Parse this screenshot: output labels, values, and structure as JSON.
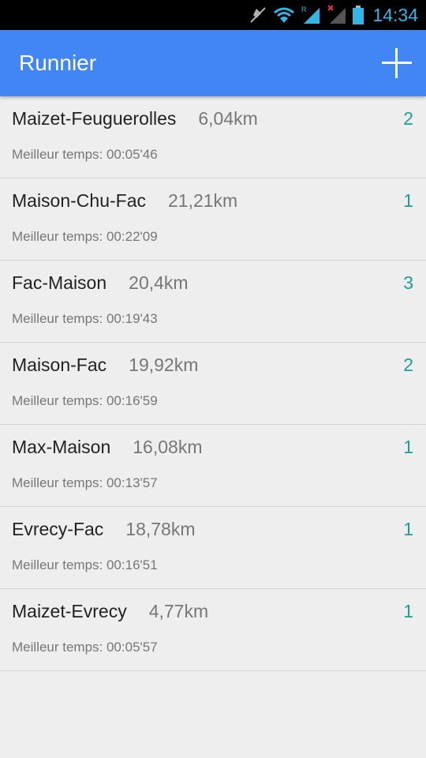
{
  "status_bar": {
    "time": "14:34",
    "time_color": "#33b5e5",
    "icons": [
      "mute-icon",
      "wifi-icon",
      "signal-roaming-icon",
      "signal-no-service-icon",
      "battery-icon"
    ]
  },
  "app_bar": {
    "title": "Runnier",
    "color": "#4285f4",
    "action_icon": "plus-icon"
  },
  "routes": [
    {
      "name": "Maizet-Feuguerolles",
      "distance": "6,04km",
      "count": "2",
      "best_time": "Meilleur temps: 00:05'46"
    },
    {
      "name": "Maison-Chu-Fac",
      "distance": "21,21km",
      "count": "1",
      "best_time": "Meilleur temps: 00:22'09"
    },
    {
      "name": "Fac-Maison",
      "distance": "20,4km",
      "count": "3",
      "best_time": "Meilleur temps: 00:19'43"
    },
    {
      "name": "Maison-Fac",
      "distance": "19,92km",
      "count": "2",
      "best_time": "Meilleur temps: 00:16'59"
    },
    {
      "name": "Max-Maison",
      "distance": "16,08km",
      "count": "1",
      "best_time": "Meilleur temps: 00:13'57"
    },
    {
      "name": "Evrecy-Fac",
      "distance": "18,78km",
      "count": "1",
      "best_time": "Meilleur temps: 00:16'51"
    },
    {
      "name": "Maizet-Evrecy",
      "distance": "4,77km",
      "count": "1",
      "best_time": "Meilleur temps: 00:05'57"
    }
  ],
  "accent_color": "#1f9e94"
}
